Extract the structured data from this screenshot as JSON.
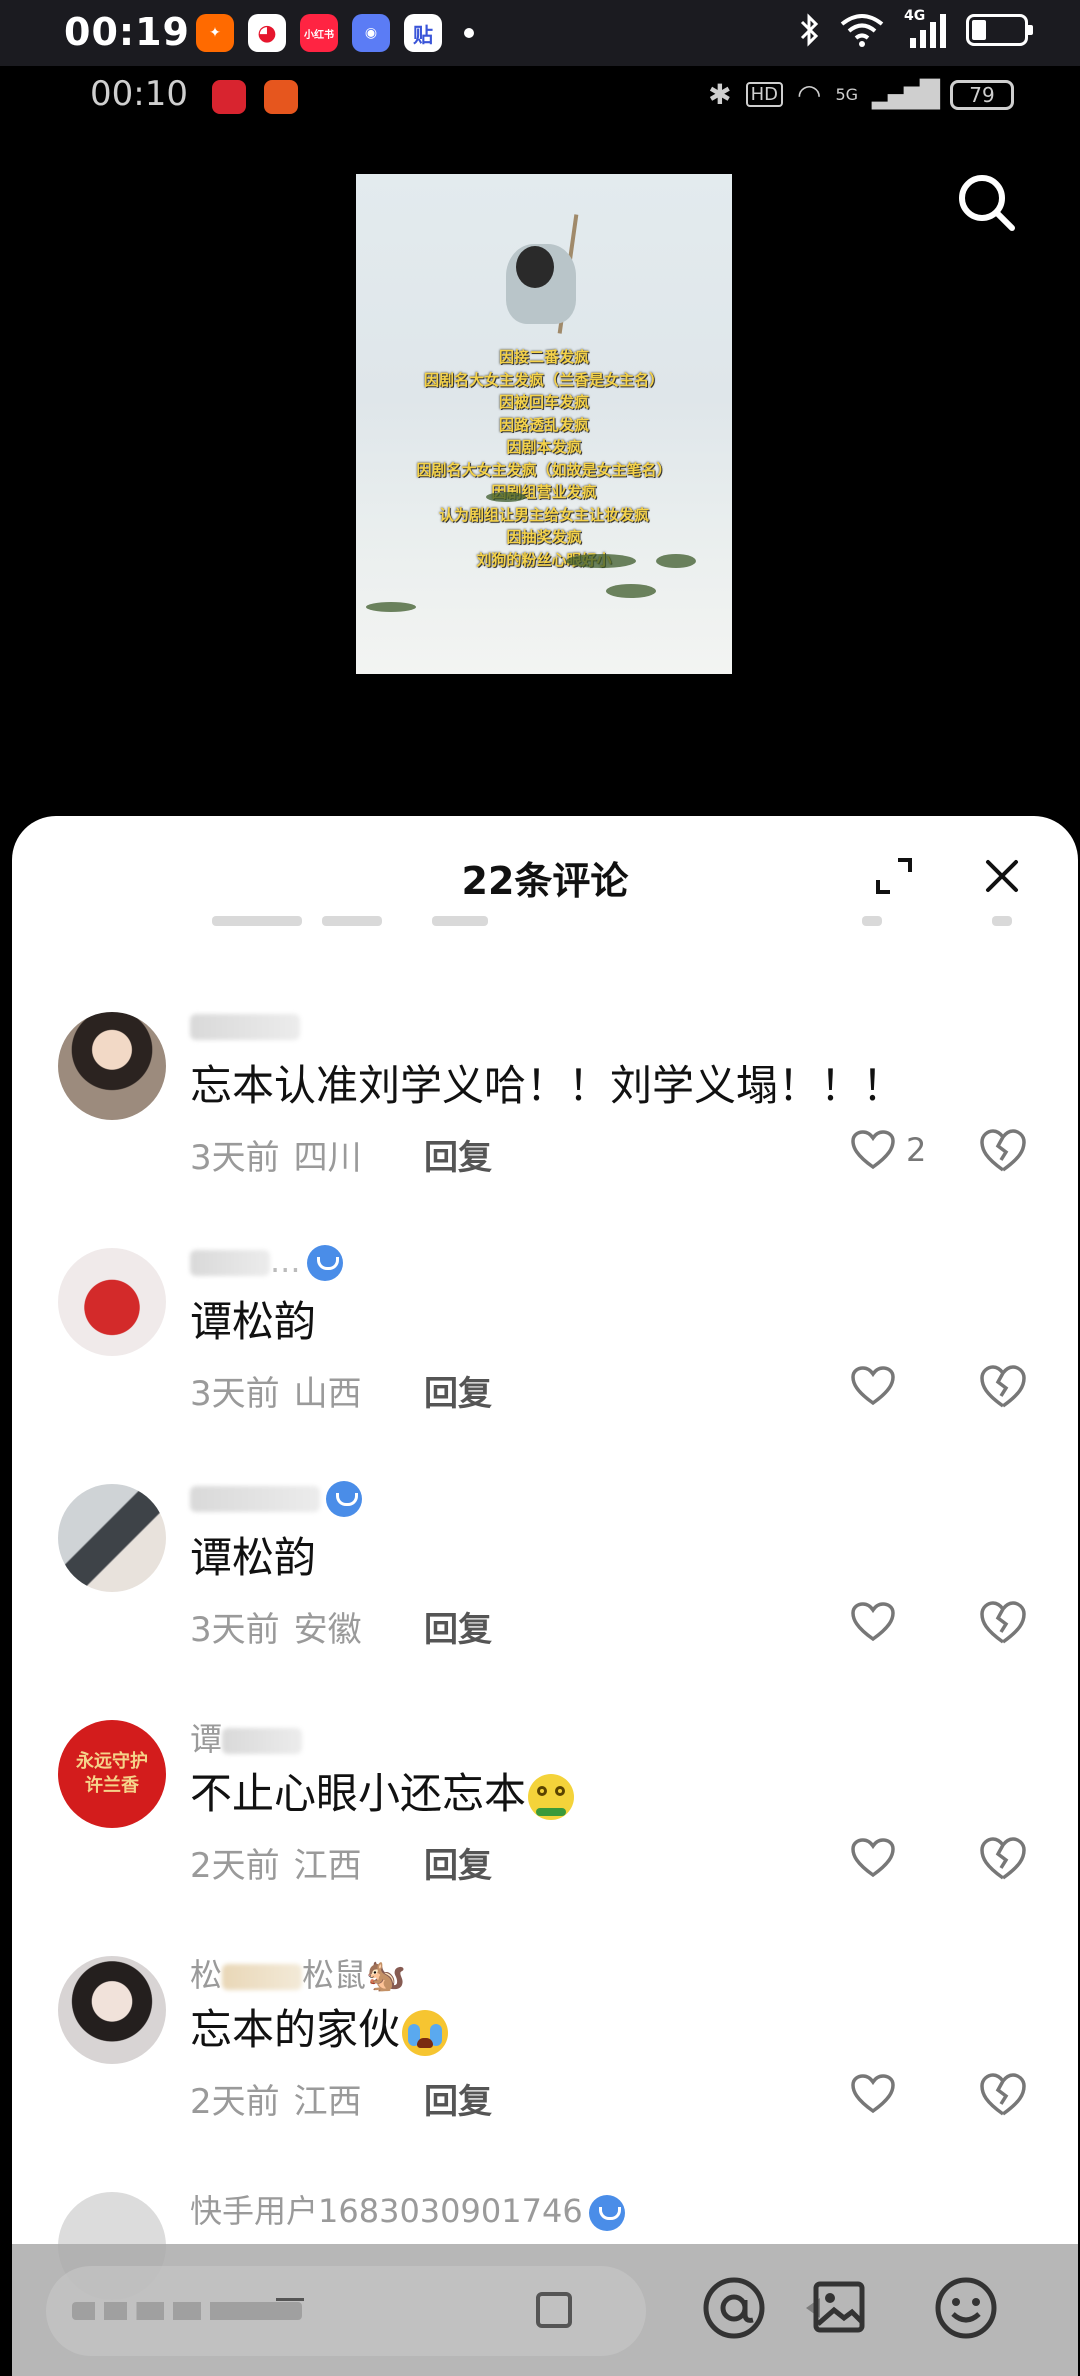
{
  "outer_status": {
    "time": "00:19",
    "network": "4G",
    "app_icons": [
      {
        "name": "taobao",
        "color": "#ff6a00",
        "glyph": "淘"
      },
      {
        "name": "weibo",
        "color": "#e6162d",
        "glyph": "微"
      },
      {
        "name": "xiaohongshu",
        "color": "#ff2442",
        "glyph": "小红书"
      },
      {
        "name": "app-blue",
        "color": "#5b7cf5",
        "glyph": "◉"
      },
      {
        "name": "tieba",
        "color": "#3a55d8",
        "glyph": "贴"
      }
    ]
  },
  "inner_status": {
    "time": "00:10",
    "network": "5G",
    "battery": "79",
    "hd": "HD"
  },
  "poster": {
    "lines": [
      "因接二番发疯",
      "因剧名大女主发疯（兰香是女主名）",
      "因被回车发疯",
      "因路透乱发疯",
      "因剧本发疯",
      "因剧名大女主发疯（如故是女主笔名）",
      "因剧组营业发疯",
      "认为剧组让男主给女主让妆发疯",
      "因抽奖发疯",
      "刘狗的粉丝心眼好小"
    ]
  },
  "sheet": {
    "title": "22条评论"
  },
  "comments": [
    {
      "name_prefix": "",
      "name_suffix": "",
      "verified": false,
      "text": "忘本认准刘学义哈！！刘学义塌！！！",
      "emoji": "",
      "time": "3天前",
      "location": "四川",
      "reply": "回复",
      "likes": "2",
      "avatar_color": "#c9a58a"
    },
    {
      "name_prefix": "",
      "name_suffix": "...",
      "verified": true,
      "text": "谭松韵",
      "emoji": "",
      "time": "3天前",
      "location": "山西",
      "reply": "回复",
      "likes": "",
      "avatar_color": "#d32a2a"
    },
    {
      "name_prefix": "",
      "name_suffix": "",
      "verified": true,
      "text": "谭松韵",
      "emoji": "",
      "time": "3天前",
      "location": "安徽",
      "reply": "回复",
      "likes": "",
      "avatar_color": "#8b8f94"
    },
    {
      "name_prefix": "谭",
      "name_suffix": "",
      "verified": false,
      "text": "不止心眼小还忘本",
      "emoji": "dizzy-face",
      "time": "2天前",
      "location": "江西",
      "reply": "回复",
      "likes": "",
      "avatar_color": "#d31c1c",
      "avatar_text": "永远守护许兰香"
    },
    {
      "name_prefix": "松",
      "name_suffix": "松鼠🐿️",
      "verified": false,
      "text": "忘本的家伙",
      "emoji": "crying-face",
      "time": "2天前",
      "location": "江西",
      "reply": "回复",
      "likes": "",
      "avatar_color": "#6f6a6c"
    }
  ],
  "partial_comment": {
    "name": "快手用户1683030901746",
    "verified": true
  }
}
